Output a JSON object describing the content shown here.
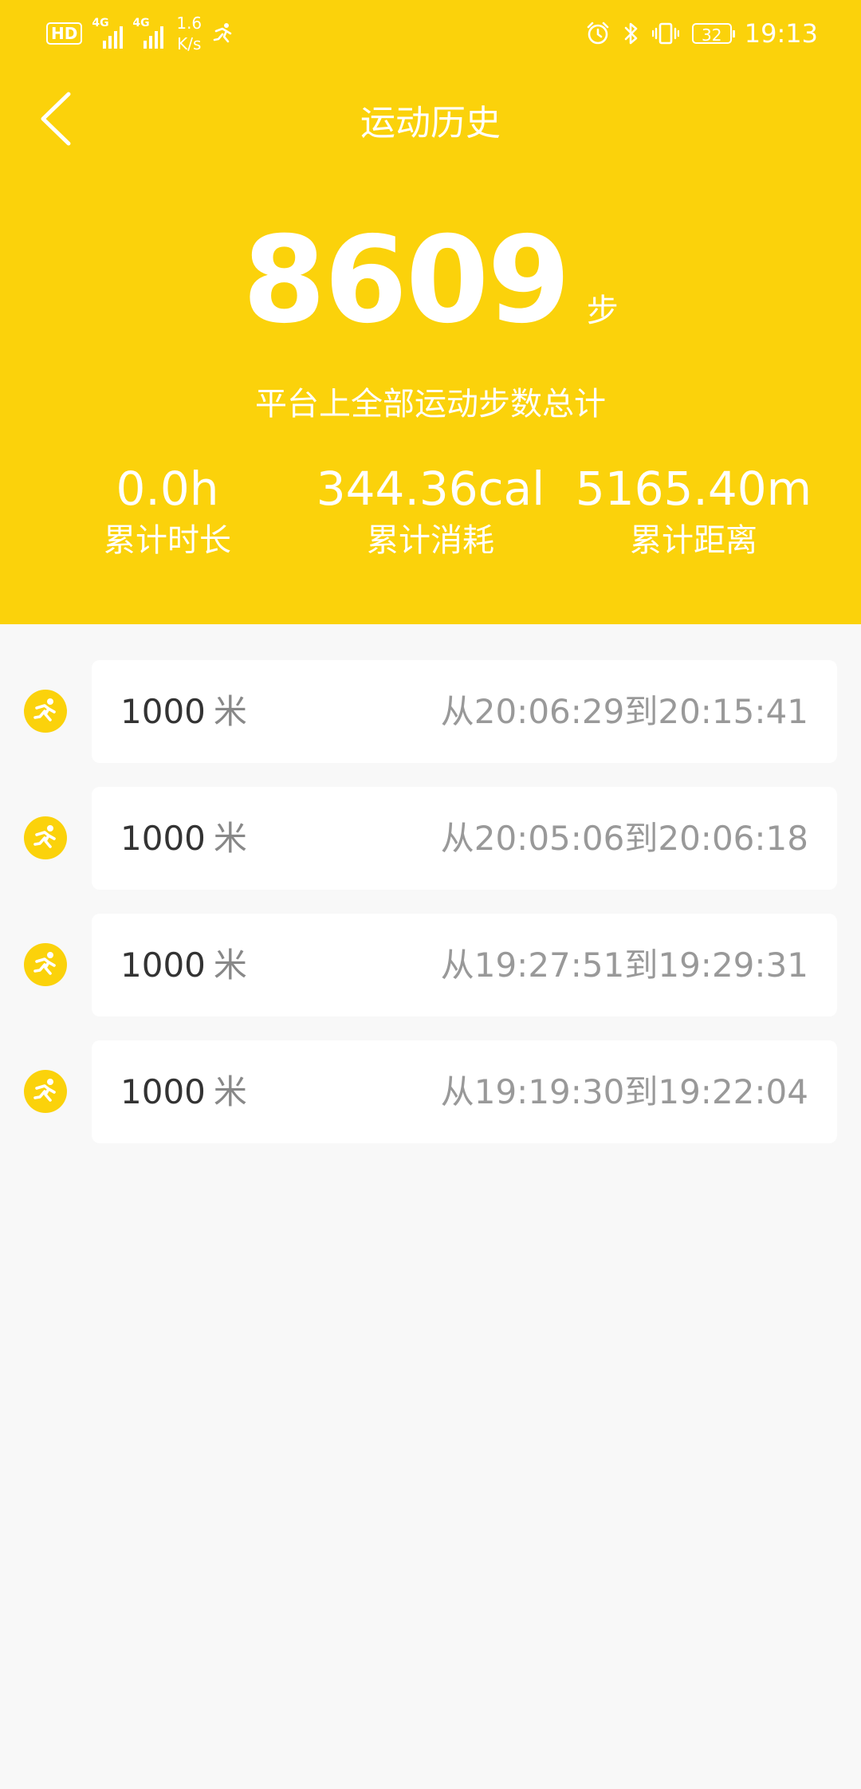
{
  "status_bar": {
    "hd": "HD",
    "network_type_1": "4G",
    "network_type_2": "4G",
    "speed_value": "1.6",
    "speed_unit": "K/s",
    "battery": "32",
    "time": "19:13"
  },
  "nav": {
    "title": "运动历史"
  },
  "summary": {
    "steps": "8609",
    "steps_unit": "步",
    "caption": "平台上全部运动步数总计",
    "stats": [
      {
        "value": "0.0h",
        "label": "累计时长"
      },
      {
        "value": "344.36cal",
        "label": "累计消耗"
      },
      {
        "value": "5165.40m",
        "label": "累计距离"
      }
    ]
  },
  "records": [
    {
      "distance": "1000",
      "unit": "米",
      "time_range": "从20:06:29到20:15:41"
    },
    {
      "distance": "1000",
      "unit": "米",
      "time_range": "从20:05:06到20:06:18"
    },
    {
      "distance": "1000",
      "unit": "米",
      "time_range": "从19:27:51到19:29:31"
    },
    {
      "distance": "1000",
      "unit": "米",
      "time_range": "从19:19:30到19:22:04"
    }
  ],
  "colors": {
    "accent": "#fbd20b",
    "background": "#f8f8f8",
    "card": "#ffffff"
  },
  "icons": {
    "back": "chevron-left-icon",
    "record": "running-icon"
  }
}
